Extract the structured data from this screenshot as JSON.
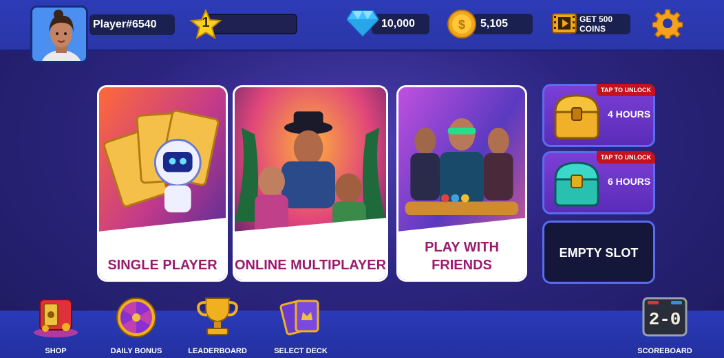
{
  "player": {
    "name": "Player#6540",
    "level": "1"
  },
  "currencies": {
    "gems": "10,000",
    "coins": "5,105",
    "video_offer": "GET 500 COINS"
  },
  "modes": [
    {
      "label": "SINGLE PLAYER"
    },
    {
      "label": "ONLINE MULTIPLAYER"
    },
    {
      "label": "PLAY WITH FRIENDS"
    }
  ],
  "slots": [
    {
      "badge": "TAP TO UNLOCK",
      "time": "4 HOURS",
      "chest": "gold-chest"
    },
    {
      "badge": "TAP TO UNLOCK",
      "time": "6 HOURS",
      "chest": "teal-chest"
    },
    {
      "label": "EMPTY SLOT"
    }
  ],
  "nav": {
    "shop": "SHOP",
    "daily_bonus": "DAILY BONUS",
    "leaderboard": "LEADERBOARD",
    "select_deck": "SELECT DECK",
    "scoreboard": "SCOREBOARD",
    "score_display": "2-0"
  },
  "icons": [
    "avatar",
    "star-icon",
    "gem-icon",
    "coin-icon",
    "film-icon",
    "gear-icon",
    "shop-icon",
    "wheel-icon",
    "trophy-icon",
    "cards-icon",
    "scoreboard-icon"
  ],
  "colors": {
    "accent": "#2c3bb6",
    "label": "#9a1a6e",
    "badge": "#c4121e"
  }
}
